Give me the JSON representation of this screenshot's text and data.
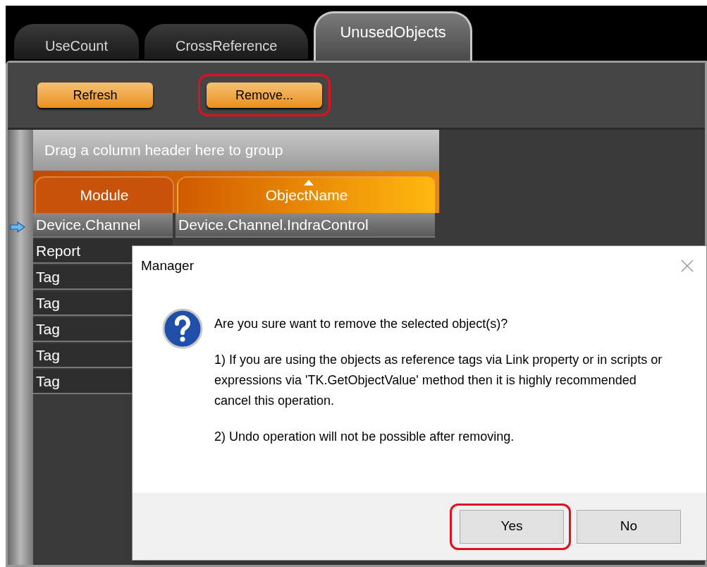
{
  "tabs": [
    {
      "label": "UseCount",
      "selected": false
    },
    {
      "label": "CrossReference",
      "selected": false
    },
    {
      "label": "UnusedObjects",
      "selected": true
    }
  ],
  "toolbar": {
    "buttons": [
      {
        "label": "Refresh",
        "highlighted": false
      },
      {
        "label": "Remove...",
        "highlighted": true
      }
    ]
  },
  "grid": {
    "group_panel": "Drag a column header here to group",
    "columns": [
      {
        "label": "Module",
        "sorted": false
      },
      {
        "label": "ObjectName",
        "sorted": true
      }
    ],
    "rows": [
      {
        "selected": true,
        "cells": [
          "Device.Channel",
          "Device.Channel.IndraControl"
        ]
      },
      {
        "selected": false,
        "cells": [
          "Report"
        ]
      },
      {
        "selected": false,
        "cells": [
          "Tag"
        ]
      },
      {
        "selected": false,
        "cells": [
          "Tag"
        ]
      },
      {
        "selected": false,
        "cells": [
          "Tag"
        ]
      },
      {
        "selected": false,
        "cells": [
          "Tag"
        ]
      },
      {
        "selected": false,
        "cells": [
          "Tag"
        ]
      }
    ]
  },
  "dialog": {
    "title": "Manager",
    "question": "Are you sure want to remove the selected object(s)?",
    "paragraphs": [
      "1) If you are using the objects as reference tags via Link property or in scripts or expressions via 'TK.GetObjectValue' method then it is highly recommended cancel this operation.",
      "2) Undo operation will not be possible after removing."
    ],
    "buttons": [
      {
        "label": "Yes",
        "highlighted": true
      },
      {
        "label": "No",
        "highlighted": false
      }
    ]
  }
}
